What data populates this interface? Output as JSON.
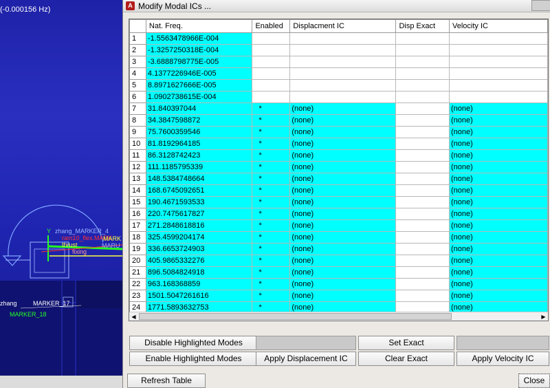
{
  "viewport": {
    "freq_label": "(-0.000156 Hz)",
    "labels": [
      "Y",
      "zhang_MARKER_4",
      "ram10_flex.MARK",
      "thrust",
      "fixing",
      "MARU",
      "MARK",
      "zhang",
      "MARKER_17",
      "MARKER_18"
    ]
  },
  "dialog": {
    "title": "Modify Modal ICs ...",
    "app_icon_letter": "A"
  },
  "table": {
    "columns": [
      "Nat. Freq.",
      "Enabled",
      "Displacment IC",
      "Disp Exact",
      "Velocity IC"
    ],
    "rows": [
      {
        "n": "1",
        "freq": "-1.5563478966E-004",
        "enabled": "",
        "disp": "",
        "exact": "",
        "vel": ""
      },
      {
        "n": "2",
        "freq": "-1.3257250318E-004",
        "enabled": "",
        "disp": "",
        "exact": "",
        "vel": ""
      },
      {
        "n": "3",
        "freq": "-3.6888798775E-005",
        "enabled": "",
        "disp": "",
        "exact": "",
        "vel": ""
      },
      {
        "n": "4",
        "freq": "4.1377226946E-005",
        "enabled": "",
        "disp": "",
        "exact": "",
        "vel": ""
      },
      {
        "n": "5",
        "freq": "8.8971627666E-005",
        "enabled": "",
        "disp": "",
        "exact": "",
        "vel": ""
      },
      {
        "n": "6",
        "freq": "1.0902738615E-004",
        "enabled": "",
        "disp": "",
        "exact": "",
        "vel": ""
      },
      {
        "n": "7",
        "freq": "31.840397044",
        "enabled": "*",
        "disp": "(none)",
        "exact": "",
        "vel": "(none)"
      },
      {
        "n": "8",
        "freq": "34.3847598872",
        "enabled": "*",
        "disp": "(none)",
        "exact": "",
        "vel": "(none)"
      },
      {
        "n": "9",
        "freq": "75.7600359546",
        "enabled": "*",
        "disp": "(none)",
        "exact": "",
        "vel": "(none)"
      },
      {
        "n": "10",
        "freq": "81.8192964185",
        "enabled": "*",
        "disp": "(none)",
        "exact": "",
        "vel": "(none)"
      },
      {
        "n": "11",
        "freq": "86.3128742423",
        "enabled": "*",
        "disp": "(none)",
        "exact": "",
        "vel": "(none)"
      },
      {
        "n": "12",
        "freq": "111.1185795339",
        "enabled": "*",
        "disp": "(none)",
        "exact": "",
        "vel": "(none)"
      },
      {
        "n": "13",
        "freq": "148.5384748664",
        "enabled": "*",
        "disp": "(none)",
        "exact": "",
        "vel": "(none)"
      },
      {
        "n": "14",
        "freq": "168.6745092651",
        "enabled": "*",
        "disp": "(none)",
        "exact": "",
        "vel": "(none)"
      },
      {
        "n": "15",
        "freq": "190.4671593533",
        "enabled": "*",
        "disp": "(none)",
        "exact": "",
        "vel": "(none)"
      },
      {
        "n": "16",
        "freq": "220.7475617827",
        "enabled": "*",
        "disp": "(none)",
        "exact": "",
        "vel": "(none)"
      },
      {
        "n": "17",
        "freq": "271.2848618816",
        "enabled": "*",
        "disp": "(none)",
        "exact": "",
        "vel": "(none)"
      },
      {
        "n": "18",
        "freq": "325.4599204174",
        "enabled": "*",
        "disp": "(none)",
        "exact": "",
        "vel": "(none)"
      },
      {
        "n": "19",
        "freq": "336.6653724903",
        "enabled": "*",
        "disp": "(none)",
        "exact": "",
        "vel": "(none)"
      },
      {
        "n": "20",
        "freq": "405.9865332276",
        "enabled": "*",
        "disp": "(none)",
        "exact": "",
        "vel": "(none)"
      },
      {
        "n": "21",
        "freq": "896.5084824918",
        "enabled": "*",
        "disp": "(none)",
        "exact": "",
        "vel": "(none)"
      },
      {
        "n": "22",
        "freq": "963.168368859",
        "enabled": "*",
        "disp": "(none)",
        "exact": "",
        "vel": "(none)"
      },
      {
        "n": "23",
        "freq": "1501.5047261616",
        "enabled": "*",
        "disp": "(none)",
        "exact": "",
        "vel": "(none)"
      },
      {
        "n": "24",
        "freq": "1771.5893632753",
        "enabled": "*",
        "disp": "(none)",
        "exact": "",
        "vel": "(none)"
      }
    ]
  },
  "buttons": {
    "disable_highlighted": "Disable Highlighted Modes",
    "enable_highlighted": "Enable Highlighted Modes",
    "apply_displacement": "Apply Displacement IC",
    "set_exact": "Set Exact",
    "clear_exact": "Clear Exact",
    "apply_velocity": "Apply Velocity IC",
    "refresh_table": "Refresh Table",
    "close": "Close"
  },
  "icons": {
    "scroll_left": "triangle-left-icon",
    "scroll_right": "triangle-right-icon"
  },
  "colors": {
    "highlight": "#00ffff",
    "viewport_bg": "#2a2fc0",
    "app_icon": "#b41e1e"
  }
}
